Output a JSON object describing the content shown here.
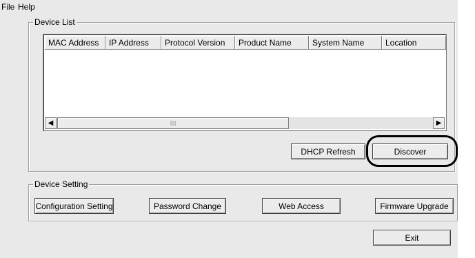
{
  "menu": {
    "file": "File",
    "help": "Help"
  },
  "device_list": {
    "legend": "Device List",
    "columns": [
      "MAC Address",
      "IP Address",
      "Protocol Version",
      "Product Name",
      "System Name",
      "Location"
    ],
    "scroll_left_glyph": "◀",
    "scroll_right_glyph": "▶",
    "thumb_grip": "||||"
  },
  "buttons": {
    "dhcp_refresh": "DHCP Refresh",
    "discover": "Discover",
    "configuration_setting": "Configuration Setting",
    "password_change": "Password Change",
    "web_access": "Web Access",
    "firmware_upgrade": "Firmware Upgrade",
    "exit": "Exit"
  },
  "device_setting": {
    "legend": "Device Setting"
  }
}
